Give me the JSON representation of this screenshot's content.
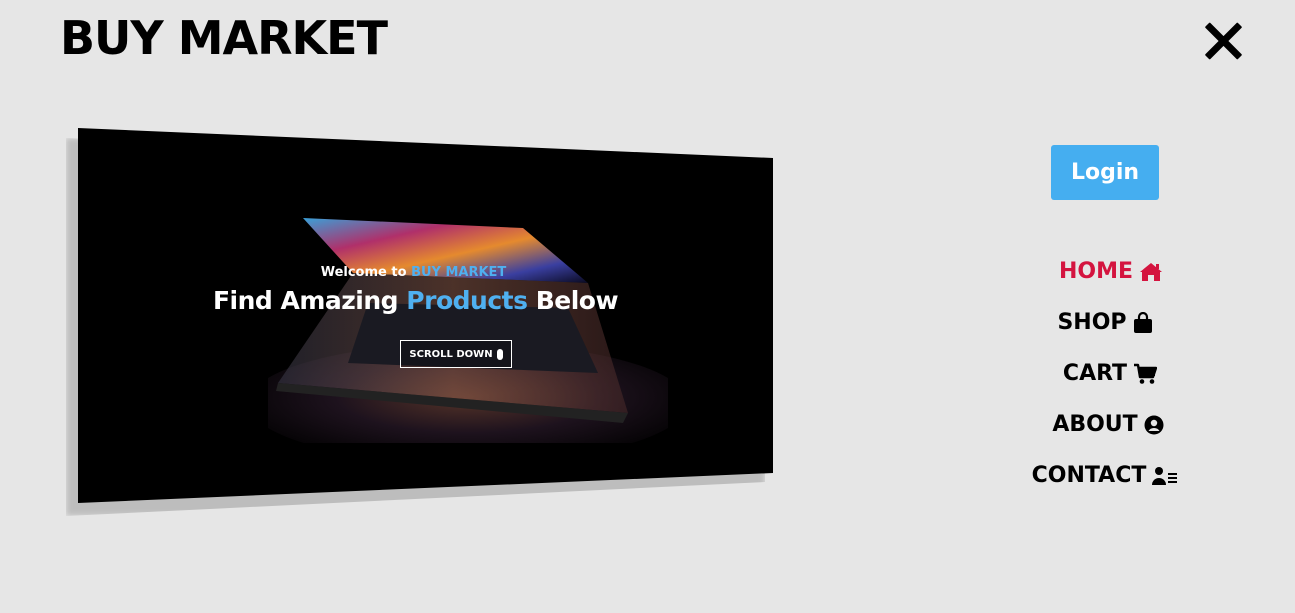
{
  "header": {
    "brand": "BUY MARKET",
    "close_icon": "close-icon"
  },
  "hero": {
    "welcome_prefix": "Welcome to",
    "welcome_brand": "BUY MARKET",
    "headline_start": "Find Amazing",
    "headline_accent": "Products",
    "headline_end": "Below",
    "scroll_label": "SCROLL DOWN",
    "scroll_icon": "mouse-icon",
    "accent_color": "#4fb0f0"
  },
  "auth": {
    "login_label": "Login",
    "login_color": "#45aef0"
  },
  "nav": {
    "active_color": "#d4143f",
    "items": [
      {
        "label": "HOME",
        "icon": "home-icon",
        "active": true
      },
      {
        "label": "SHOP",
        "icon": "shopping-bag-icon",
        "active": false
      },
      {
        "label": "CART",
        "icon": "cart-icon",
        "active": false
      },
      {
        "label": "ABOUT",
        "icon": "user-circle-icon",
        "active": false
      },
      {
        "label": "CONTACT",
        "icon": "address-card-icon",
        "active": false
      }
    ]
  }
}
